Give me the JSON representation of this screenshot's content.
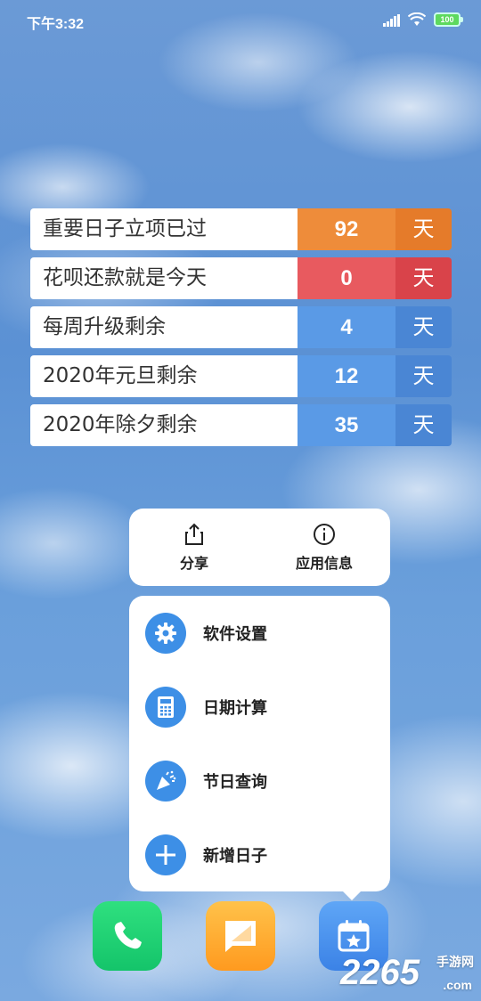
{
  "status_bar": {
    "time": "下午3:32",
    "battery": "100"
  },
  "countdowns": [
    {
      "label": "重要日子立项已过",
      "days": "92",
      "unit": "天",
      "num_color": "#ee8c3a",
      "unit_color": "#e57b2a"
    },
    {
      "label": "花呗还款就是今天",
      "days": "0",
      "unit": "天",
      "num_color": "#e85a5f",
      "unit_color": "#d9434a"
    },
    {
      "label": "每周升级剩余",
      "days": "4",
      "unit": "天",
      "num_color": "#5a9ae6",
      "unit_color": "#4a86d4"
    },
    {
      "label": "2020年元旦剩余",
      "days": "12",
      "unit": "天",
      "num_color": "#5a9ae6",
      "unit_color": "#4a86d4"
    },
    {
      "label": "2020年除夕剩余",
      "days": "35",
      "unit": "天",
      "num_color": "#5a9ae6",
      "unit_color": "#4a86d4"
    }
  ],
  "share_popup": {
    "share_label": "分享",
    "info_label": "应用信息"
  },
  "menu": {
    "items": [
      {
        "label": "软件设置",
        "icon": "gear-icon"
      },
      {
        "label": "日期计算",
        "icon": "calculator-icon"
      },
      {
        "label": "节日查询",
        "icon": "party-popper-icon"
      },
      {
        "label": "新增日子",
        "icon": "plus-icon"
      }
    ]
  },
  "dock": {
    "apps": [
      {
        "icon": "phone-icon",
        "color": "#1cd274"
      },
      {
        "icon": "message-icon",
        "color": "#ffae33"
      },
      {
        "icon": "calendar-star-icon",
        "color": "#4a92ee"
      }
    ]
  },
  "watermark": {
    "number": "2265",
    "site_cn": "手游网",
    "domain": ".com"
  }
}
